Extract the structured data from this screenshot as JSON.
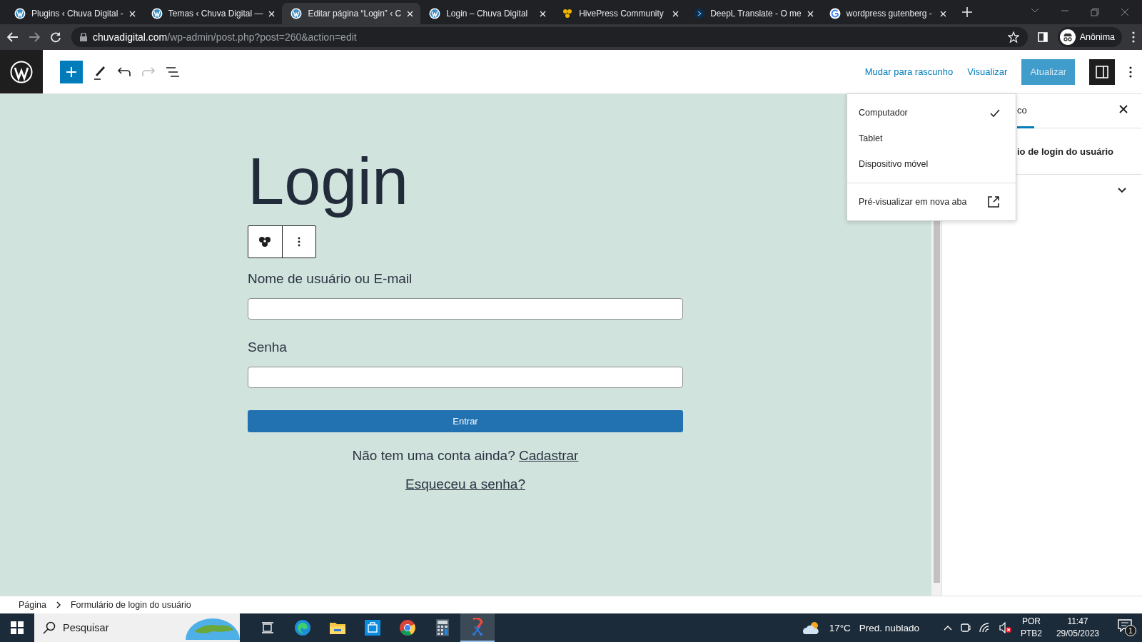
{
  "browser": {
    "tabs": [
      {
        "title": "Plugins ‹ Chuva Digital -",
        "kind": "wp",
        "selected": false
      },
      {
        "title": "Temas ‹ Chuva Digital —",
        "kind": "wp",
        "selected": false
      },
      {
        "title": "Editar página “Login” ‹ C",
        "kind": "wp",
        "selected": true
      },
      {
        "title": "Login – Chuva Digital",
        "kind": "wp",
        "selected": false
      },
      {
        "title": "HivePress Community",
        "kind": "hive",
        "selected": false
      },
      {
        "title": "DeepL Translate - O me",
        "kind": "deepl",
        "selected": false
      },
      {
        "title": "wordpress gutenberg -",
        "kind": "google",
        "selected": false
      }
    ],
    "url": {
      "host": "chuvadigital.com",
      "path": "/wp-admin/post.php?post=260&action=edit"
    },
    "profile": "Anônima"
  },
  "editor": {
    "actions": [
      "Mudar para rascunho",
      "Visualizar"
    ],
    "primary": {
      "label": "Atualizar",
      "disabled": true
    },
    "settings_open": true
  },
  "preview_menu": {
    "items": [
      {
        "label": "Computador",
        "selected": true
      },
      {
        "label": "Tablet",
        "selected": false
      },
      {
        "label": "Dispositivo móvel",
        "selected": false
      }
    ],
    "new_tab": "Pré-visualizar em nova aba"
  },
  "canvas": {
    "title": "Login",
    "fields": [
      {
        "label": "Nome de usuário ou E-mail"
      },
      {
        "label": "Senha"
      }
    ],
    "button": "Entrar",
    "register_prompt": "Não tem uma conta ainda?",
    "register_link": "Cadastrar",
    "forgot_link": "Esqueceu a senha?"
  },
  "sidebar": {
    "tab": "co",
    "block_title": "io de login do usuário"
  },
  "breadcrumb": [
    "Página",
    "Formulário de login do usuário"
  ],
  "taskbar": {
    "search_placeholder": "Pesquisar",
    "apps": [
      {
        "kind": "taskview",
        "active": false
      },
      {
        "kind": "edge",
        "active": false
      },
      {
        "kind": "explorer",
        "active": false
      },
      {
        "kind": "store",
        "active": false
      },
      {
        "kind": "chrome",
        "active": false
      },
      {
        "kind": "calculator",
        "active": false
      },
      {
        "kind": "snip",
        "active": true
      }
    ],
    "temperature": "17°C",
    "weather": "Pred. nublado",
    "language": "POR",
    "layout": "PTB2",
    "time": "11:47",
    "date": "29/05/2023",
    "notifications": "1"
  }
}
